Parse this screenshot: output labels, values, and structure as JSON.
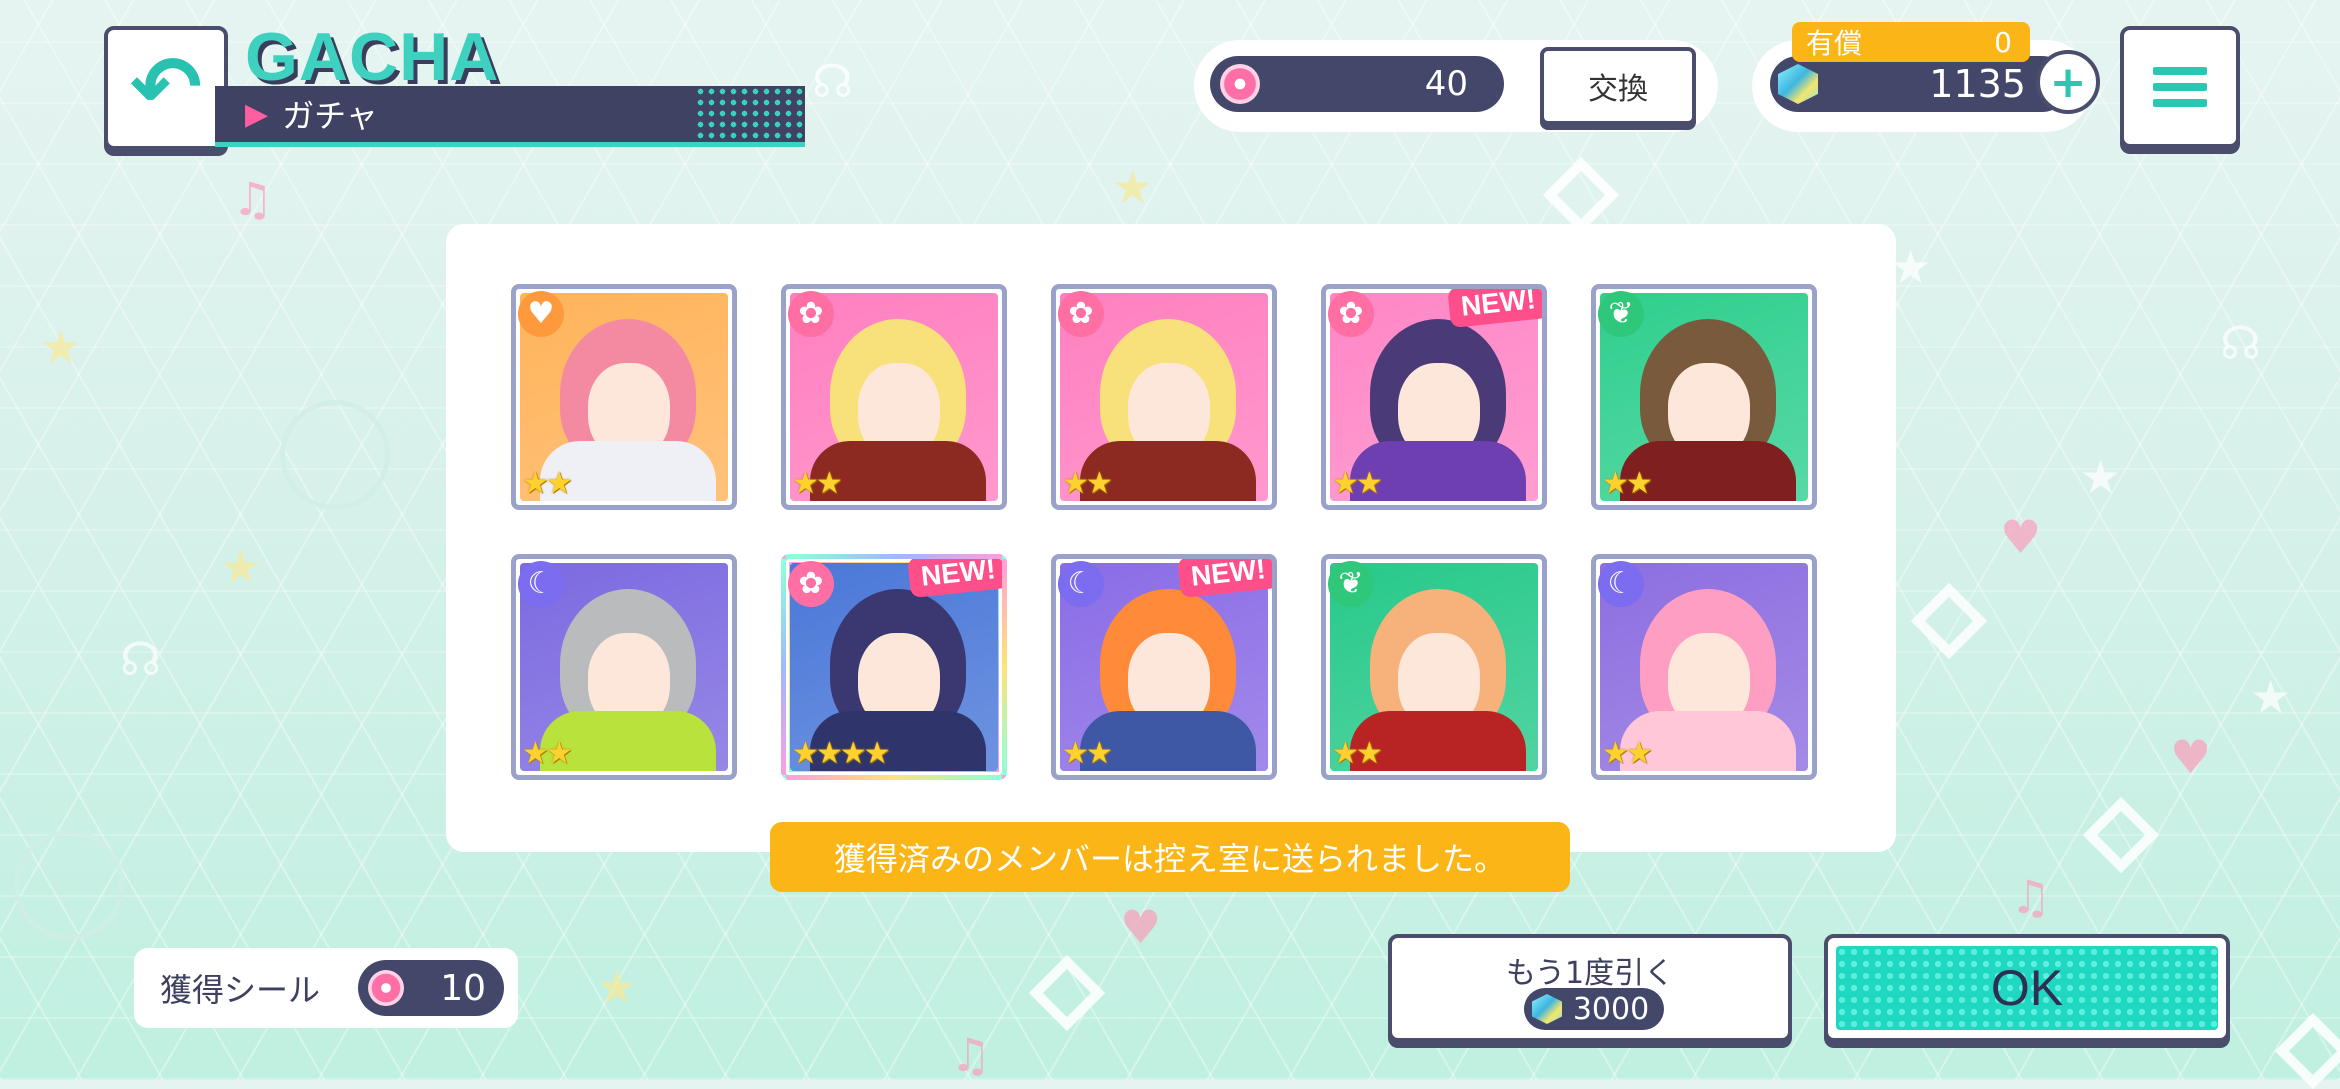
{
  "header": {
    "back_icon": "back-arrow-icon",
    "title_en": "GACHA",
    "title_jp": "ガチャ"
  },
  "currency": {
    "seal_icon": "seal-coin-icon",
    "seal_count": "40",
    "exchange_label": "交換",
    "paid_label": "有償",
    "paid_count": "0",
    "gem_icon": "crystal-gem-icon",
    "gem_count": "1135",
    "plus_label": "+",
    "menu_icon": "hamburger-menu-icon"
  },
  "results": {
    "cards": [
      {
        "attribute": "happy",
        "attr_glyph": "♥",
        "rarity": 2,
        "stars": "★★",
        "new": false,
        "hair_color": "#f48aa1",
        "bg": "#ffb35a",
        "outfit": "#eef0f6"
      },
      {
        "attribute": "cute",
        "attr_glyph": "✿",
        "rarity": 2,
        "stars": "★★",
        "new": false,
        "hair_color": "#f8e07a",
        "bg": "#ff7fc0",
        "outfit": "#8c2a21"
      },
      {
        "attribute": "cute",
        "attr_glyph": "✿",
        "rarity": 2,
        "stars": "★★",
        "new": false,
        "hair_color": "#f8e07a",
        "bg": "#ff7fc0",
        "outfit": "#8c2a21"
      },
      {
        "attribute": "cute",
        "attr_glyph": "✿",
        "rarity": 2,
        "stars": "★★",
        "new": true,
        "hair_color": "#4a3b78",
        "bg": "#ff86c6",
        "outfit": "#6e3fb0"
      },
      {
        "attribute": "pure",
        "attr_glyph": "❦",
        "rarity": 2,
        "stars": "★★",
        "new": false,
        "hair_color": "#7a5a3d",
        "bg": "#2fcf8e",
        "outfit": "#7f1f1f"
      },
      {
        "attribute": "cool",
        "attr_glyph": "☾",
        "rarity": 2,
        "stars": "★★",
        "new": false,
        "hair_color": "#b9bbbd",
        "bg": "#7c6ae0",
        "outfit": "#b9e23c"
      },
      {
        "attribute": "cute",
        "attr_glyph": "✿",
        "rarity": 4,
        "stars": "★★★★",
        "new": true,
        "hair_color": "#3b3770",
        "bg": "#4a78d8",
        "outfit": "#2f356a"
      },
      {
        "attribute": "cool",
        "attr_glyph": "☾",
        "rarity": 2,
        "stars": "★★",
        "new": true,
        "hair_color": "#ff8a3a",
        "bg": "#8a6ce6",
        "outfit": "#3e58a6"
      },
      {
        "attribute": "pure",
        "attr_glyph": "❦",
        "rarity": 2,
        "stars": "★★",
        "new": false,
        "hair_color": "#f6b27a",
        "bg": "#27c98a",
        "outfit": "#b82323"
      },
      {
        "attribute": "cool",
        "attr_glyph": "☾",
        "rarity": 2,
        "stars": "★★",
        "new": false,
        "hair_color": "#ff9ec3",
        "bg": "#8d6ee0",
        "outfit": "#ffc7d8"
      }
    ],
    "new_label": "NEW!",
    "notice": "獲得済みのメンバーは控え室に送られました。"
  },
  "footer": {
    "seal_label": "獲得シール",
    "seal_earned": "10",
    "again_label": "もう1度引く",
    "again_cost": "3000",
    "ok_label": "OK"
  },
  "colors": {
    "accent": "#2bc7b2",
    "navy": "#43476a",
    "notice": "#fbb516",
    "new_badge": "#ff4f8b"
  }
}
